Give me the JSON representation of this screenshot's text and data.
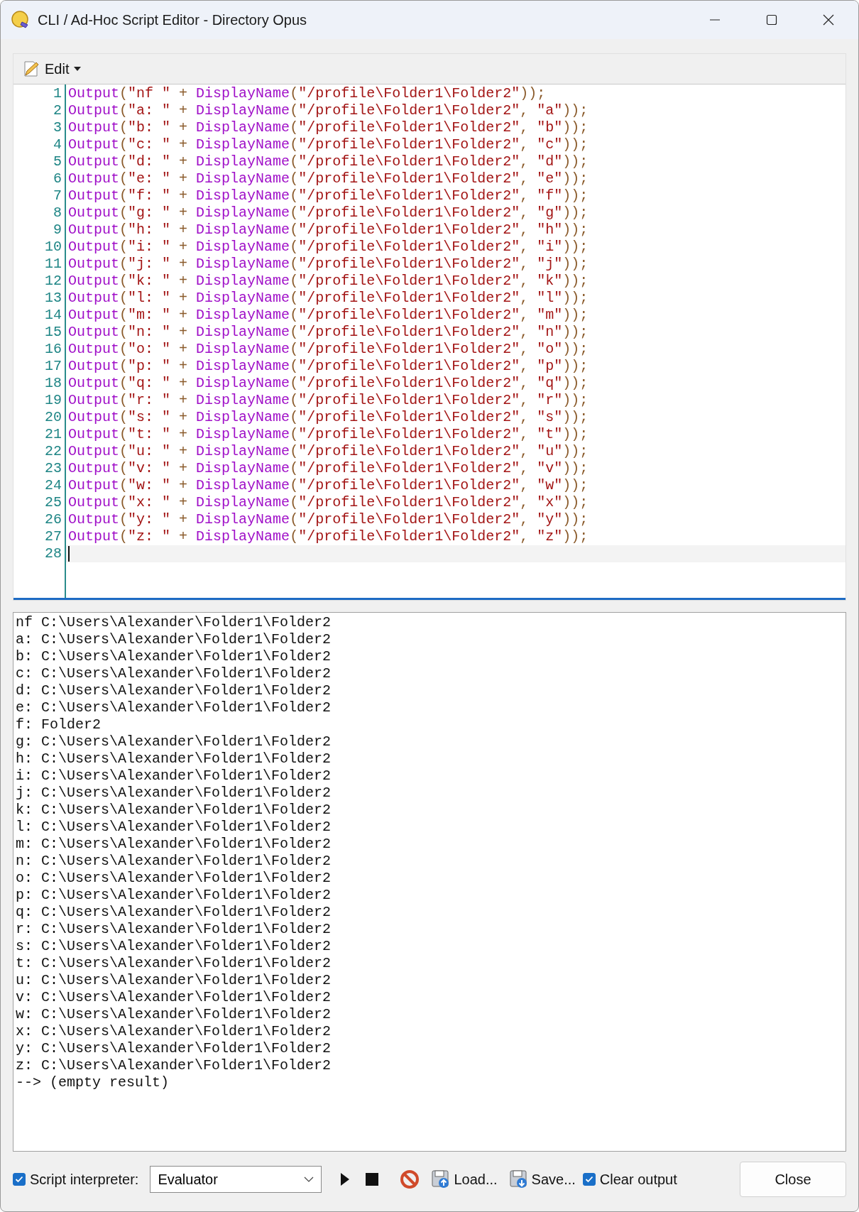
{
  "window": {
    "title": "CLI / Ad-Hoc Script Editor - Directory Opus"
  },
  "toolbar": {
    "edit_menu": "Edit"
  },
  "editor": {
    "lines": [
      {
        "number": "1",
        "code": "Output(\"nf \" + DisplayName(\"/profile\\Folder1\\Folder2\"));",
        "current": false
      },
      {
        "number": "2",
        "code": "Output(\"a: \" + DisplayName(\"/profile\\Folder1\\Folder2\", \"a\"));",
        "current": false
      },
      {
        "number": "3",
        "code": "Output(\"b: \" + DisplayName(\"/profile\\Folder1\\Folder2\", \"b\"));",
        "current": false
      },
      {
        "number": "4",
        "code": "Output(\"c: \" + DisplayName(\"/profile\\Folder1\\Folder2\", \"c\"));",
        "current": false
      },
      {
        "number": "5",
        "code": "Output(\"d: \" + DisplayName(\"/profile\\Folder1\\Folder2\", \"d\"));",
        "current": false
      },
      {
        "number": "6",
        "code": "Output(\"e: \" + DisplayName(\"/profile\\Folder1\\Folder2\", \"e\"));",
        "current": false
      },
      {
        "number": "7",
        "code": "Output(\"f: \" + DisplayName(\"/profile\\Folder1\\Folder2\", \"f\"));",
        "current": false
      },
      {
        "number": "8",
        "code": "Output(\"g: \" + DisplayName(\"/profile\\Folder1\\Folder2\", \"g\"));",
        "current": false
      },
      {
        "number": "9",
        "code": "Output(\"h: \" + DisplayName(\"/profile\\Folder1\\Folder2\", \"h\"));",
        "current": false
      },
      {
        "number": "10",
        "code": "Output(\"i: \" + DisplayName(\"/profile\\Folder1\\Folder2\", \"i\"));",
        "current": false
      },
      {
        "number": "11",
        "code": "Output(\"j: \" + DisplayName(\"/profile\\Folder1\\Folder2\", \"j\"));",
        "current": false
      },
      {
        "number": "12",
        "code": "Output(\"k: \" + DisplayName(\"/profile\\Folder1\\Folder2\", \"k\"));",
        "current": false
      },
      {
        "number": "13",
        "code": "Output(\"l: \" + DisplayName(\"/profile\\Folder1\\Folder2\", \"l\"));",
        "current": false
      },
      {
        "number": "14",
        "code": "Output(\"m: \" + DisplayName(\"/profile\\Folder1\\Folder2\", \"m\"));",
        "current": false
      },
      {
        "number": "15",
        "code": "Output(\"n: \" + DisplayName(\"/profile\\Folder1\\Folder2\", \"n\"));",
        "current": false
      },
      {
        "number": "16",
        "code": "Output(\"o: \" + DisplayName(\"/profile\\Folder1\\Folder2\", \"o\"));",
        "current": false
      },
      {
        "number": "17",
        "code": "Output(\"p: \" + DisplayName(\"/profile\\Folder1\\Folder2\", \"p\"));",
        "current": false
      },
      {
        "number": "18",
        "code": "Output(\"q: \" + DisplayName(\"/profile\\Folder1\\Folder2\", \"q\"));",
        "current": false
      },
      {
        "number": "19",
        "code": "Output(\"r: \" + DisplayName(\"/profile\\Folder1\\Folder2\", \"r\"));",
        "current": false
      },
      {
        "number": "20",
        "code": "Output(\"s: \" + DisplayName(\"/profile\\Folder1\\Folder2\", \"s\"));",
        "current": false
      },
      {
        "number": "21",
        "code": "Output(\"t: \" + DisplayName(\"/profile\\Folder1\\Folder2\", \"t\"));",
        "current": false
      },
      {
        "number": "22",
        "code": "Output(\"u: \" + DisplayName(\"/profile\\Folder1\\Folder2\", \"u\"));",
        "current": false
      },
      {
        "number": "23",
        "code": "Output(\"v: \" + DisplayName(\"/profile\\Folder1\\Folder2\", \"v\"));",
        "current": false
      },
      {
        "number": "24",
        "code": "Output(\"w: \" + DisplayName(\"/profile\\Folder1\\Folder2\", \"w\"));",
        "current": false
      },
      {
        "number": "25",
        "code": "Output(\"x: \" + DisplayName(\"/profile\\Folder1\\Folder2\", \"x\"));",
        "current": false
      },
      {
        "number": "26",
        "code": "Output(\"y: \" + DisplayName(\"/profile\\Folder1\\Folder2\", \"y\"));",
        "current": false
      },
      {
        "number": "27",
        "code": "Output(\"z: \" + DisplayName(\"/profile\\Folder1\\Folder2\", \"z\"));",
        "current": false
      },
      {
        "number": "28",
        "current": true
      }
    ]
  },
  "output": {
    "lines": [
      "nf C:\\Users\\Alexander\\Folder1\\Folder2",
      "a: C:\\Users\\Alexander\\Folder1\\Folder2",
      "b: C:\\Users\\Alexander\\Folder1\\Folder2",
      "c: C:\\Users\\Alexander\\Folder1\\Folder2",
      "d: C:\\Users\\Alexander\\Folder1\\Folder2",
      "e: C:\\Users\\Alexander\\Folder1\\Folder2",
      "f: Folder2",
      "g: C:\\Users\\Alexander\\Folder1\\Folder2",
      "h: C:\\Users\\Alexander\\Folder1\\Folder2",
      "i: C:\\Users\\Alexander\\Folder1\\Folder2",
      "j: C:\\Users\\Alexander\\Folder1\\Folder2",
      "k: C:\\Users\\Alexander\\Folder1\\Folder2",
      "l: C:\\Users\\Alexander\\Folder1\\Folder2",
      "m: C:\\Users\\Alexander\\Folder1\\Folder2",
      "n: C:\\Users\\Alexander\\Folder1\\Folder2",
      "o: C:\\Users\\Alexander\\Folder1\\Folder2",
      "p: C:\\Users\\Alexander\\Folder1\\Folder2",
      "q: C:\\Users\\Alexander\\Folder1\\Folder2",
      "r: C:\\Users\\Alexander\\Folder1\\Folder2",
      "s: C:\\Users\\Alexander\\Folder1\\Folder2",
      "t: C:\\Users\\Alexander\\Folder1\\Folder2",
      "u: C:\\Users\\Alexander\\Folder1\\Folder2",
      "v: C:\\Users\\Alexander\\Folder1\\Folder2",
      "w: C:\\Users\\Alexander\\Folder1\\Folder2",
      "x: C:\\Users\\Alexander\\Folder1\\Folder2",
      "y: C:\\Users\\Alexander\\Folder1\\Folder2",
      "z: C:\\Users\\Alexander\\Folder1\\Folder2",
      "--> (empty result)"
    ]
  },
  "bottom_bar": {
    "script_interpreter": {
      "label": "Script interpreter:",
      "checked": true,
      "value": "Evaluator"
    },
    "load": "Load...",
    "save": "Save...",
    "clear_output": {
      "label": "Clear output",
      "checked": true
    },
    "close": "Close"
  }
}
